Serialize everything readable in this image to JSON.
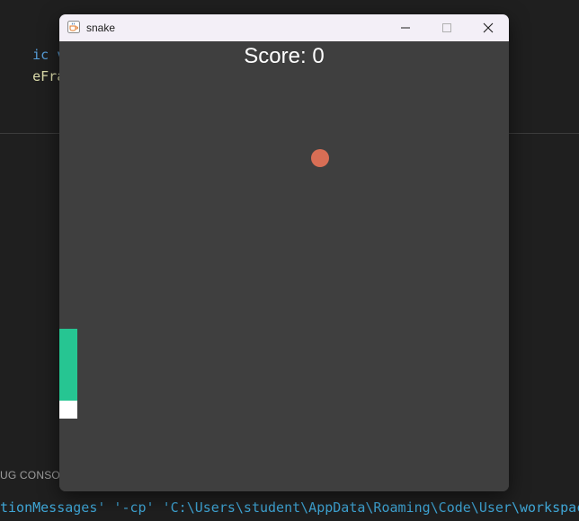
{
  "ide": {
    "code_line1_kw": "ic void",
    "code_line2_fn": "eFrame(",
    "code_line2_paren": ")",
    "panel_tab": "UG CONSOLE",
    "terminal_text": "tionMessages' '-cp' 'C:\\Users\\student\\AppData\\Roaming\\Code\\User\\workspace"
  },
  "window": {
    "title": "snake",
    "icon": "java-cup-icon",
    "controls": [
      "minimize-icon",
      "maximize-icon",
      "close-icon"
    ]
  },
  "game": {
    "score_text": "Score: 0",
    "food_color": "#d86e55",
    "snake_color": "#26c592",
    "snake_tail_color": "#ffffff",
    "snake_segments": 5,
    "background_color": "#3f3f3f"
  }
}
